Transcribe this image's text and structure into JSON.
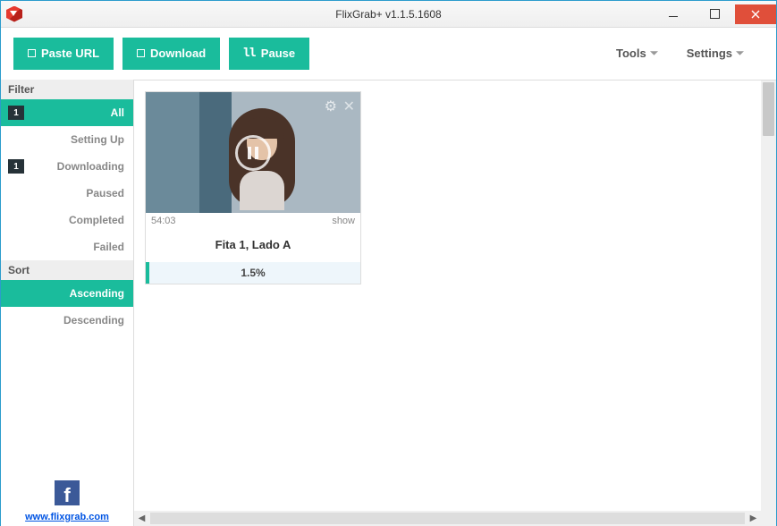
{
  "window": {
    "title": "FlixGrab+ v1.1.5.1608"
  },
  "toolbar": {
    "paste": "Paste URL",
    "download": "Download",
    "pause": "Pause",
    "tools": "Tools",
    "settings": "Settings"
  },
  "sidebar": {
    "filter_header": "Filter",
    "sort_header": "Sort",
    "filters": {
      "all": {
        "label": "All",
        "count": "1"
      },
      "setting_up": {
        "label": "Setting Up"
      },
      "downloading": {
        "label": "Downloading",
        "count": "1"
      },
      "paused": {
        "label": "Paused"
      },
      "completed": {
        "label": "Completed"
      },
      "failed": {
        "label": "Failed"
      }
    },
    "sort": {
      "asc": "Ascending",
      "desc": "Descending"
    }
  },
  "footer": {
    "link": "www.flixgrab.com"
  },
  "card": {
    "duration": "54:03",
    "action": "show",
    "title": "Fita 1, Lado A",
    "progress": "1.5%"
  }
}
